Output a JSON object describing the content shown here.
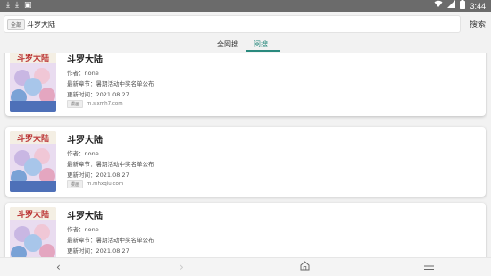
{
  "status_bar": {
    "time": "3:44",
    "icons": [
      "download-icon",
      "download-icon",
      "app-notification-icon",
      "wifi-icon",
      "signal-icon",
      "battery-icon"
    ]
  },
  "search": {
    "scope_label": "全部",
    "query": "斗罗大陆",
    "button_label": "搜索"
  },
  "tabs": [
    {
      "label": "全网搜",
      "active": false
    },
    {
      "label": "阅搜",
      "active": true
    }
  ],
  "accent_color": "#2a8a7e",
  "results": [
    {
      "title": "斗罗大陆",
      "author": "作者：none",
      "latest_chapter": "最新章节：暑期活动中奖名单公布",
      "updated": "更新时间：2021.08.27",
      "source_tag": "漫画",
      "source_domain": "m.sixmh7.com"
    },
    {
      "title": "斗罗大陆",
      "author": "作者：none",
      "latest_chapter": "最新章节：暑期活动中奖名单公布",
      "updated": "更新时间：2021.08.27",
      "source_tag": "漫画",
      "source_domain": "m.mhxqiu.com"
    },
    {
      "title": "斗罗大陆",
      "author": "作者：none",
      "latest_chapter": "最新章节：暑期活动中奖名单公布",
      "updated": "更新时间：2021.08.27"
    }
  ],
  "nav_bar": {
    "icons": [
      "back-icon",
      "forward-icon",
      "home-icon",
      "menu-icon"
    ]
  }
}
